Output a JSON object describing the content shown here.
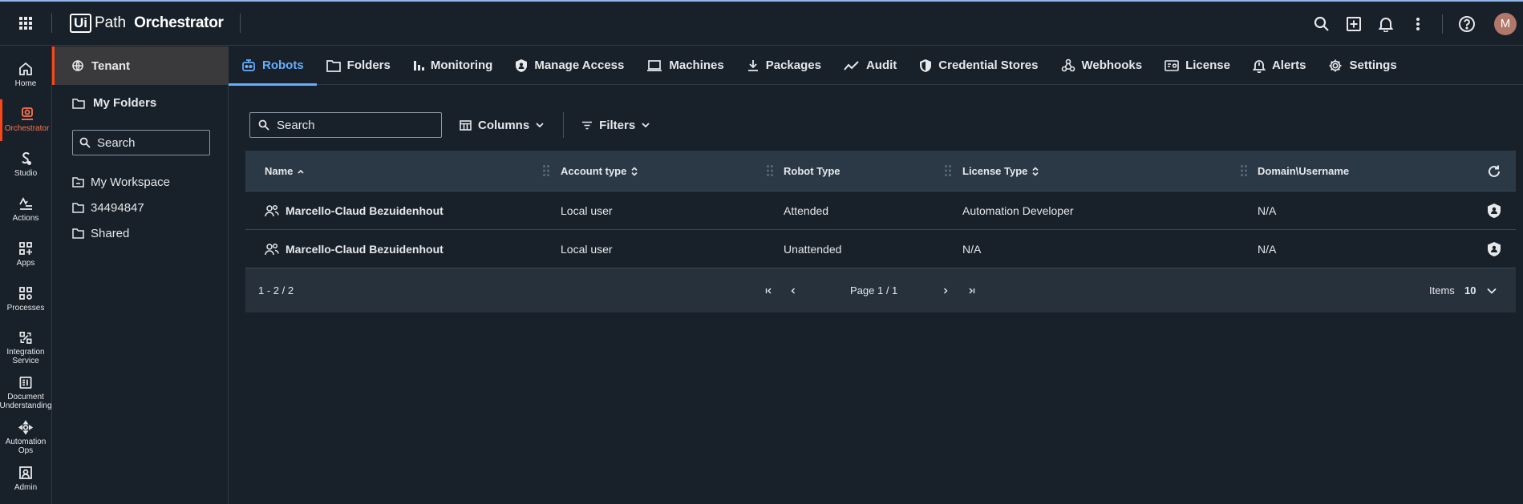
{
  "brand": {
    "mark": "Ui",
    "path": "Path",
    "product": "Orchestrator"
  },
  "topbar": {
    "avatar_initial": "M"
  },
  "leftnav": [
    {
      "label": "Home",
      "icon": "home-icon"
    },
    {
      "label": "Orchestrator",
      "icon": "orchestrator-icon",
      "active": true
    },
    {
      "label": "Studio",
      "icon": "studio-icon"
    },
    {
      "label": "Actions",
      "icon": "actions-icon"
    },
    {
      "label": "Apps",
      "icon": "apps-icon"
    },
    {
      "label": "Processes",
      "icon": "processes-icon"
    },
    {
      "label": "Integration Service",
      "icon": "integration-icon"
    },
    {
      "label": "Document Understanding",
      "icon": "document-icon"
    },
    {
      "label": "Automation Ops",
      "icon": "automation-ops-icon"
    },
    {
      "label": "Admin",
      "icon": "admin-icon"
    }
  ],
  "folders": {
    "tenant": "Tenant",
    "my_folders": "My Folders",
    "search_placeholder": "Search",
    "items": [
      "My Workspace",
      "34494847",
      "Shared"
    ]
  },
  "tabs": [
    {
      "label": "Robots",
      "icon": "robot-icon",
      "active": true
    },
    {
      "label": "Folders",
      "icon": "folder-icon"
    },
    {
      "label": "Monitoring",
      "icon": "bar-chart-icon"
    },
    {
      "label": "Manage Access",
      "icon": "shield-icon"
    },
    {
      "label": "Machines",
      "icon": "laptop-icon"
    },
    {
      "label": "Packages",
      "icon": "download-icon"
    },
    {
      "label": "Audit",
      "icon": "trend-icon"
    },
    {
      "label": "Credential Stores",
      "icon": "shield-check-icon"
    },
    {
      "label": "Webhooks",
      "icon": "webhook-icon"
    },
    {
      "label": "License",
      "icon": "license-icon"
    },
    {
      "label": "Alerts",
      "icon": "bell-icon"
    },
    {
      "label": "Settings",
      "icon": "gear-icon"
    }
  ],
  "toolbar": {
    "search_placeholder": "Search",
    "columns": "Columns",
    "filters": "Filters"
  },
  "table": {
    "columns": [
      "Name",
      "Account type",
      "Robot Type",
      "License Type",
      "Domain\\Username"
    ],
    "rows": [
      {
        "name": "Marcello-Claud Bezuidenhout",
        "account_type": "Local user",
        "robot_type": "Attended",
        "license_type": "Automation Developer",
        "domain_username": "N/A"
      },
      {
        "name": "Marcello-Claud Bezuidenhout",
        "account_type": "Local user",
        "robot_type": "Unattended",
        "license_type": "N/A",
        "domain_username": "N/A"
      }
    ]
  },
  "pagination": {
    "range": "1 - 2 / 2",
    "page": "Page 1 / 1",
    "items_label": "Items",
    "items_value": "10"
  }
}
